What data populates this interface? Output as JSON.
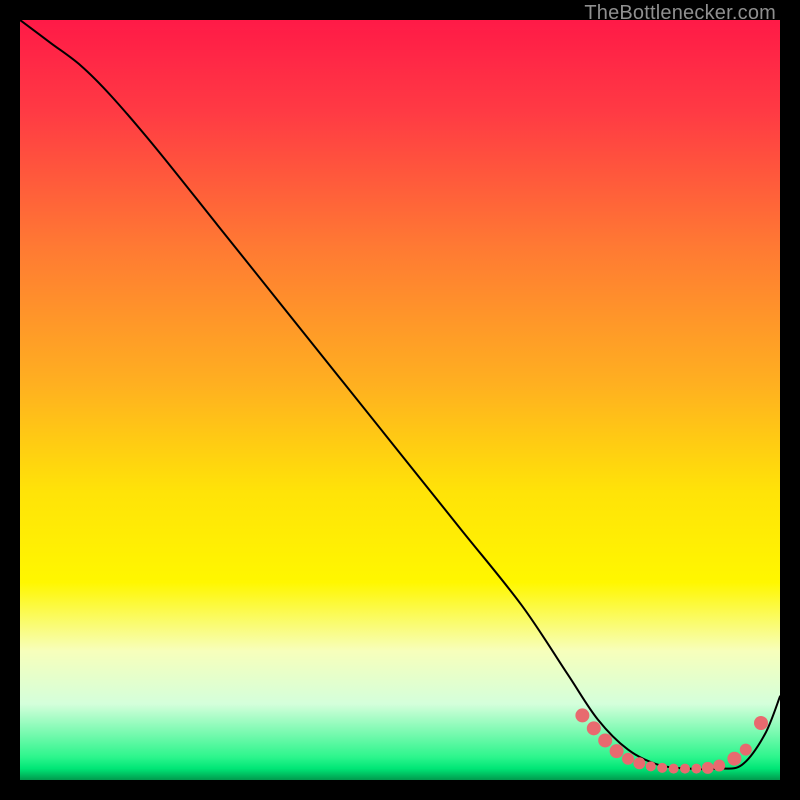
{
  "watermark": "TheBottlenecker.com",
  "chart_data": {
    "type": "line",
    "title": "",
    "xlabel": "",
    "ylabel": "",
    "xlim": [
      0,
      100
    ],
    "ylim": [
      0,
      100
    ],
    "background_gradient": {
      "direction": "vertical",
      "stops": [
        {
          "offset": 0.0,
          "color": "#ff1a47"
        },
        {
          "offset": 0.12,
          "color": "#ff3a44"
        },
        {
          "offset": 0.3,
          "color": "#ff7a33"
        },
        {
          "offset": 0.48,
          "color": "#ffb020"
        },
        {
          "offset": 0.62,
          "color": "#ffe308"
        },
        {
          "offset": 0.74,
          "color": "#fff700"
        },
        {
          "offset": 0.83,
          "color": "#f7ffbb"
        },
        {
          "offset": 0.9,
          "color": "#d4ffdb"
        },
        {
          "offset": 0.97,
          "color": "#2cf58c"
        },
        {
          "offset": 0.985,
          "color": "#00e676"
        },
        {
          "offset": 1.0,
          "color": "#009a4d"
        }
      ]
    },
    "series": [
      {
        "name": "bottleneck-curve",
        "color": "#000000",
        "stroke_width": 2,
        "x": [
          0,
          4,
          8,
          12,
          18,
          26,
          34,
          42,
          50,
          58,
          66,
          72,
          76,
          80,
          84,
          88,
          92,
          95,
          98,
          100
        ],
        "y": [
          100,
          97,
          94,
          90,
          83,
          73,
          63,
          53,
          43,
          33,
          23,
          14,
          8,
          4,
          2,
          1.5,
          1.5,
          2,
          6,
          11
        ]
      }
    ],
    "markers": {
      "name": "highlight-points",
      "color": "#e86a6f",
      "radius": [
        7,
        7,
        7,
        7,
        6,
        6,
        5,
        5,
        5,
        5,
        5,
        6,
        6,
        7,
        6,
        7
      ],
      "points": [
        {
          "x": 74.0,
          "y": 8.5
        },
        {
          "x": 75.5,
          "y": 6.8
        },
        {
          "x": 77.0,
          "y": 5.2
        },
        {
          "x": 78.5,
          "y": 3.8
        },
        {
          "x": 80.0,
          "y": 2.8
        },
        {
          "x": 81.5,
          "y": 2.2
        },
        {
          "x": 83.0,
          "y": 1.8
        },
        {
          "x": 84.5,
          "y": 1.6
        },
        {
          "x": 86.0,
          "y": 1.5
        },
        {
          "x": 87.5,
          "y": 1.5
        },
        {
          "x": 89.0,
          "y": 1.5
        },
        {
          "x": 90.5,
          "y": 1.6
        },
        {
          "x": 92.0,
          "y": 1.9
        },
        {
          "x": 94.0,
          "y": 2.8
        },
        {
          "x": 95.5,
          "y": 4.0
        },
        {
          "x": 97.5,
          "y": 7.5
        }
      ]
    }
  }
}
